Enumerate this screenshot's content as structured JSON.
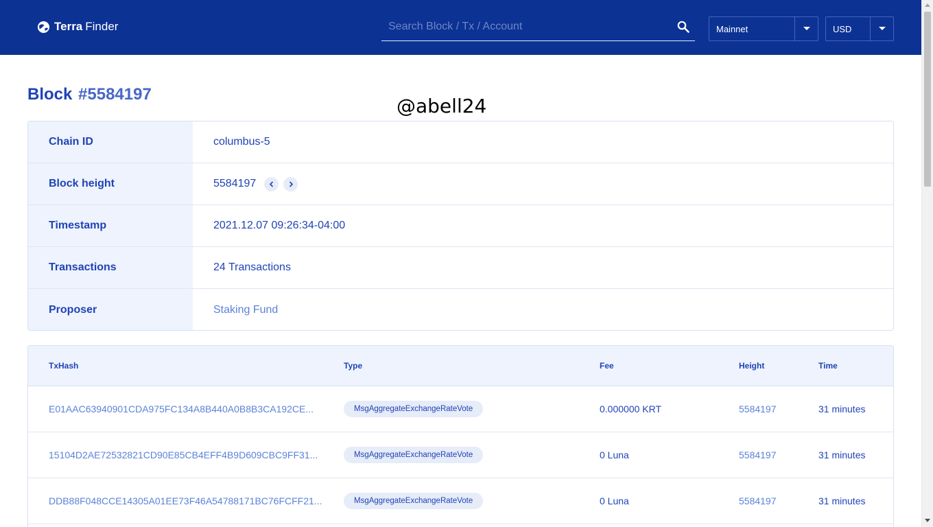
{
  "header": {
    "logo_bold": "Terra",
    "logo_light": "Finder",
    "search_placeholder": "Search Block / Tx / Account",
    "network": "Mainnet",
    "currency": "USD"
  },
  "page": {
    "title_label": "Block",
    "title_number": "#5584197",
    "watermark": "@abell24"
  },
  "details": [
    {
      "key": "Chain ID",
      "value": "columbus-5"
    },
    {
      "key": "Block height",
      "value": "5584197"
    },
    {
      "key": "Timestamp",
      "value": "2021.12.07 09:26:34-04:00"
    },
    {
      "key": "Transactions",
      "value": "24 Transactions"
    },
    {
      "key": "Proposer",
      "value": "Staking Fund"
    }
  ],
  "table": {
    "columns": [
      "TxHash",
      "Type",
      "Fee",
      "Height",
      "Time"
    ],
    "rows": [
      {
        "hash": "E01AAC63940901CDA975FC134A8B440A0B8B3CA192CE...",
        "type": "MsgAggregateExchangeRateVote",
        "fee": "0.000000 KRT",
        "height": "5584197",
        "time": "31 minutes"
      },
      {
        "hash": "15104D2AE72532821CD90E85CB4EFF4B9D609CBC9FF31...",
        "type": "MsgAggregateExchangeRateVote",
        "fee": "0 Luna",
        "height": "5584197",
        "time": "31 minutes"
      },
      {
        "hash": "DDB88F048CCE14305A01EE73F46A54788171BC76FCFF21...",
        "type": "MsgAggregateExchangeRateVote",
        "fee": "0 Luna",
        "height": "5584197",
        "time": "31 minutes"
      }
    ]
  },
  "colors": {
    "header_bg": "#0c3294",
    "primary_text": "#2043b5",
    "link": "#5b82d8",
    "key_bg": "#eef3fd"
  }
}
